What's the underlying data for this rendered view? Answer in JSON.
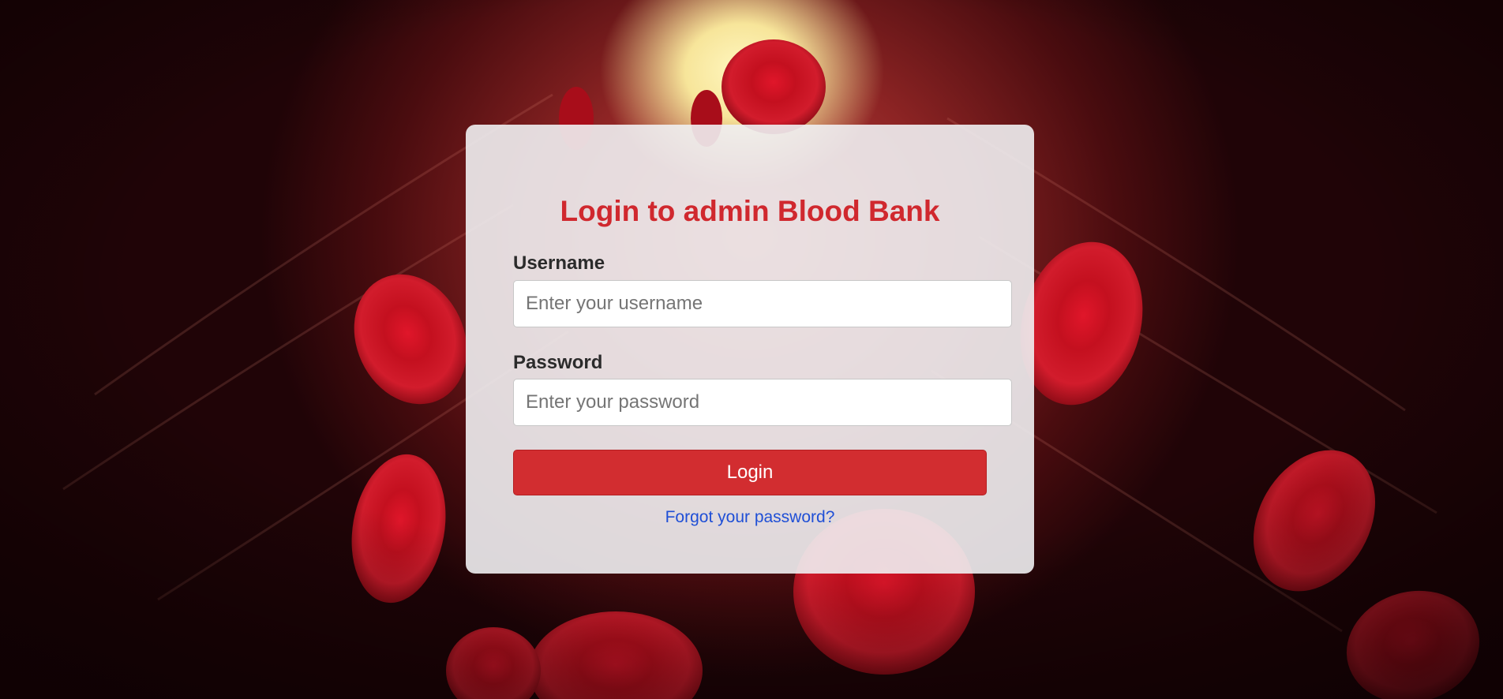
{
  "login": {
    "title": "Login to admin Blood Bank",
    "username_label": "Username",
    "username_placeholder": "Enter your username",
    "username_value": "",
    "password_label": "Password",
    "password_placeholder": "Enter your password",
    "password_value": "",
    "submit_label": "Login",
    "forgot_link": "Forgot your password?"
  },
  "colors": {
    "accent": "#d22d30",
    "title": "#d0282e",
    "link": "#1f4fd6",
    "card": "#f0f0f2"
  },
  "background": {
    "image": "red-blood-cells-in-vessel"
  }
}
